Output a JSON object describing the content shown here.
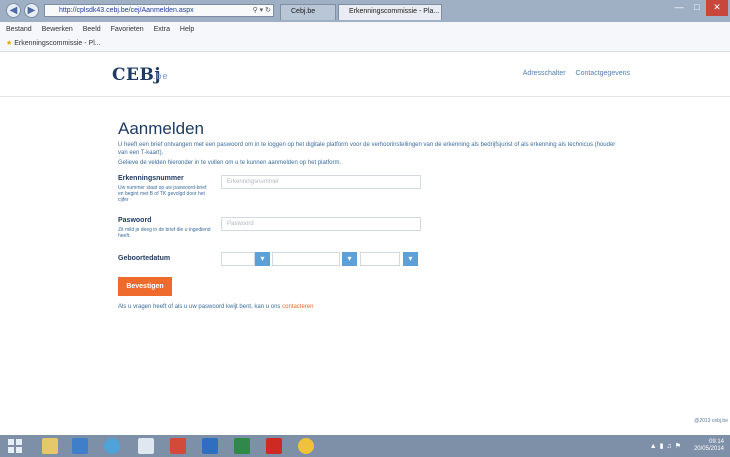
{
  "browser": {
    "address": "http://cplsdk43.cebj.be/cej/Aanmelden.aspx",
    "tab_inactive": "Cebj.be",
    "tab_active": "Erkenningscommissie - Pla...",
    "menu": [
      "Bestand",
      "Bewerken",
      "Beeld",
      "Favorieten",
      "Extra",
      "Help"
    ],
    "favorite": "Erkenningscommissie - Pl..."
  },
  "site": {
    "logo": "CEBj",
    "logo_sub": ".be",
    "nav": [
      "Adresschalter",
      "Contactgegevens"
    ]
  },
  "form": {
    "title": "Aanmelden",
    "intro": "U heeft een brief ontvangen met een paswoord om in te loggen op het digitale platform voor de verhoorinstellingen van de erkenning als bedrijfsjurist of als erkenning als technicus (houder van een T-kaart).",
    "intro2": "Gelieve de velden hieronder in te vullen om u te kunnen aanmelden op het platform.",
    "fields": [
      {
        "label": "Erkenningsnummer",
        "help": "Uw nummer staat op uw paswoord-brief en begint met B of TK gevolgd door het cijfer",
        "placeholder": "Erkenningsnummer"
      },
      {
        "label": "Paswoord",
        "help": "Zit mild je deeg in de brief die u ingediend heeft.",
        "placeholder": "Paswoord"
      }
    ],
    "birthdate_label": "Geboortedatum",
    "submit": "Bevestigen",
    "footnote": "Als u vragen heeft of als u uw paswoord kwijt bent, kan u ons",
    "footnote_link": "contacteren"
  },
  "copyright": "@2013 cebj.be",
  "taskbar": {
    "time": "09:14",
    "date": "20/05/2014"
  }
}
